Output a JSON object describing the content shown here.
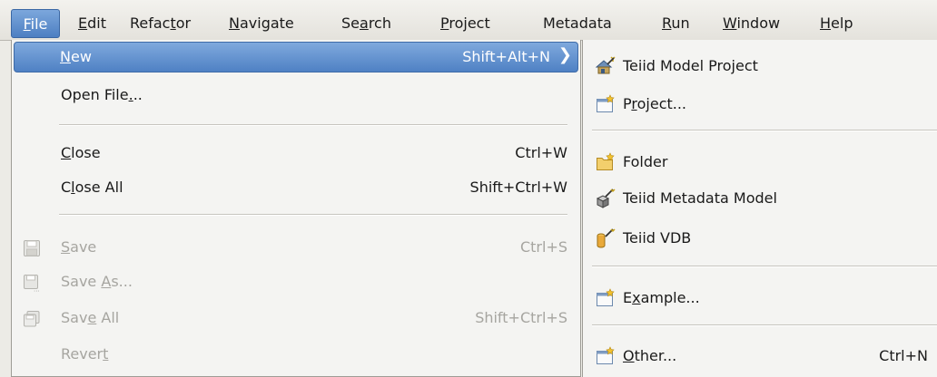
{
  "menubar": {
    "items": [
      {
        "label": "File",
        "mnemonic": "F"
      },
      {
        "label": "Edit",
        "mnemonic": "E"
      },
      {
        "label": "Refactor",
        "mnemonic": "t"
      },
      {
        "label": "Navigate",
        "mnemonic": "N"
      },
      {
        "label": "Search",
        "mnemonic": "a"
      },
      {
        "label": "Project",
        "mnemonic": "P"
      },
      {
        "label": "Metadata",
        "mnemonic": ""
      },
      {
        "label": "Run",
        "mnemonic": "R"
      },
      {
        "label": "Window",
        "mnemonic": "W"
      },
      {
        "label": "Help",
        "mnemonic": "H"
      }
    ]
  },
  "file_menu": {
    "new": {
      "label": "New",
      "accel": "Shift+Alt+N"
    },
    "open_file": {
      "label": "Open File...",
      "accel": ""
    },
    "close": {
      "label": "Close",
      "accel": "Ctrl+W"
    },
    "close_all": {
      "label": "Close All",
      "accel": "Shift+Ctrl+W"
    },
    "save": {
      "label": "Save",
      "accel": "Ctrl+S",
      "icon": "save-icon",
      "enabled": false
    },
    "save_as": {
      "label": "Save As...",
      "accel": "",
      "icon": "save-as-icon",
      "enabled": false
    },
    "save_all": {
      "label": "Save All",
      "accel": "Shift+Ctrl+S",
      "icon": "save-all-icon",
      "enabled": false
    },
    "revert": {
      "label": "Revert",
      "accel": "",
      "enabled": false
    }
  },
  "new_submenu": {
    "items": [
      {
        "label": "Teiid Model Project",
        "icon": "teiid-model-project-icon",
        "accel": ""
      },
      {
        "label": "Project...",
        "icon": "new-project-icon",
        "accel": ""
      },
      {
        "label": "Folder",
        "icon": "new-folder-icon",
        "accel": ""
      },
      {
        "label": "Teiid Metadata Model",
        "icon": "teiid-metadata-model-icon",
        "accel": ""
      },
      {
        "label": "Teiid VDB",
        "icon": "teiid-vdb-icon",
        "accel": ""
      },
      {
        "label": "Example...",
        "icon": "new-example-icon",
        "accel": ""
      },
      {
        "label": "Other...",
        "icon": "new-other-icon",
        "accel": "Ctrl+N"
      }
    ]
  },
  "colors": {
    "highlight": "#4f81c4",
    "menu_bg": "#f4f4f2",
    "disabled_text": "#a6a5a0"
  }
}
